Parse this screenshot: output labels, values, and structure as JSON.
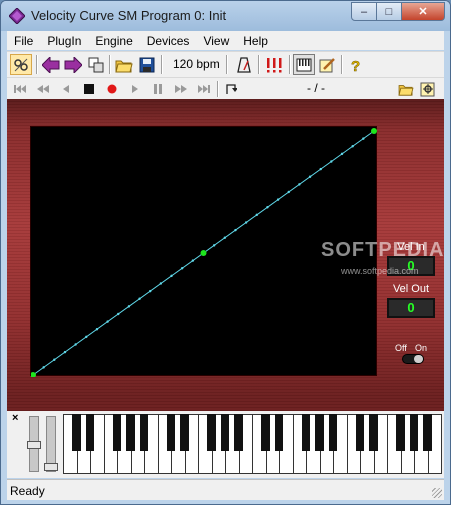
{
  "window": {
    "title": "Velocity Curve SM Program 0: Init",
    "controls": {
      "minimize": "–",
      "maximize": "□",
      "close": "✕"
    }
  },
  "menu": [
    "File",
    "PlugIn",
    "Engine",
    "Devices",
    "View",
    "Help"
  ],
  "toolbar": {
    "tempo": "120 bpm",
    "icons": [
      "properties-icon",
      "back-arrow-icon",
      "forward-arrow-icon",
      "copy-window-icon",
      "open-folder-icon",
      "save-disk-icon",
      "metronome-icon",
      "panic-icon",
      "keyboard-icon",
      "edit-icon",
      "help-icon"
    ]
  },
  "transport": {
    "position": "- / -",
    "icons": [
      "to-start-icon",
      "rewind-icon",
      "step-back-icon",
      "stop-icon",
      "record-icon",
      "play-icon",
      "pause-icon",
      "fast-forward-icon",
      "to-end-icon",
      "loop-icon",
      "open-folder-icon",
      "settings-icon"
    ]
  },
  "plugin": {
    "vel_in_label": "Vel In",
    "vel_in_value": "0",
    "vel_out_label": "Vel Out",
    "vel_out_value": "0",
    "toggle_off_label": "Off",
    "toggle_on_label": "On",
    "toggle_state": "on",
    "curve_color": "#5fd7e8",
    "point_color": "#1ee51e"
  },
  "watermark": {
    "text": "SOFTPEDIA",
    "sub": "www.softpedia.com"
  },
  "keyboard": {
    "close_label": "×",
    "white_keys": 28
  },
  "status": {
    "text": "Ready"
  }
}
